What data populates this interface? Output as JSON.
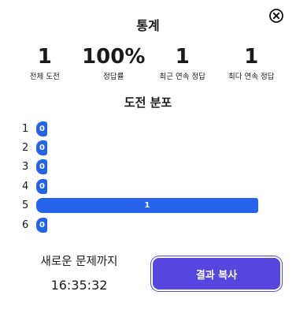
{
  "title": "통계",
  "stats": [
    {
      "value": "1",
      "label": "전체 도전"
    },
    {
      "value": "100%",
      "label": "정답률"
    },
    {
      "value": "1",
      "label": "최근 연속 정답"
    },
    {
      "value": "1",
      "label": "최다 연속 정답"
    }
  ],
  "distribution": {
    "title": "도전 분포",
    "rows": [
      {
        "label": "1",
        "count": "0",
        "value": 0
      },
      {
        "label": "2",
        "count": "0",
        "value": 0
      },
      {
        "label": "3",
        "count": "0",
        "value": 0
      },
      {
        "label": "4",
        "count": "0",
        "value": 0
      },
      {
        "label": "5",
        "count": "1",
        "value": 1
      },
      {
        "label": "6",
        "count": "0",
        "value": 0
      }
    ],
    "max": 1
  },
  "next": {
    "label": "새로운 문제까지",
    "countdown": "16:35:32"
  },
  "copy_button": "결과 복사",
  "colors": {
    "bar": "#2563eb",
    "button": "#5646e0"
  },
  "icons": {
    "close": "close-icon"
  }
}
